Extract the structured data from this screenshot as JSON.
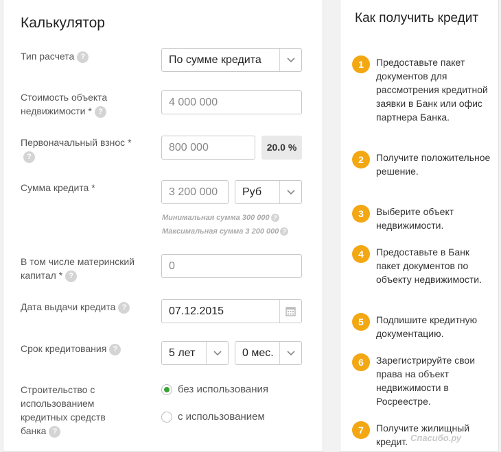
{
  "calculator": {
    "title": "Калькулятор",
    "calc_type": {
      "label": "Тип расчета",
      "value": "По сумме кредита"
    },
    "property_cost": {
      "label": "Стоимость объекта недвижимости *",
      "value": "4 000 000"
    },
    "down_payment": {
      "label": "Первоначальный взнос *",
      "value": "800 000",
      "percent": "20.0 %"
    },
    "loan_amount": {
      "label": "Сумма кредита *",
      "value": "3 200 000",
      "currency": "Руб",
      "min_hint": "Минимальная сумма 300 000",
      "max_hint": "Максимальная сумма 3 200 000"
    },
    "maternity_capital": {
      "label": "В том числе материнский капитал *",
      "value": "0"
    },
    "issue_date": {
      "label": "Дата выдачи кредита",
      "value": "07.12.2015"
    },
    "term": {
      "label": "Срок кредитования",
      "years": "5 лет",
      "months": "0 мес."
    },
    "construction": {
      "label": "Строительство с использованием кредитных средств банка",
      "options": [
        {
          "label": "без использования",
          "selected": true
        },
        {
          "label": "с использованием",
          "selected": false
        }
      ]
    },
    "help_glyph": "?"
  },
  "sidebar": {
    "title": "Как получить кредит",
    "steps": [
      {
        "num": "1",
        "text": "Предоставьте пакет документов для рассмотрения кредитной заявки в Банк или офис партнера Банка."
      },
      {
        "num": "2",
        "text": "Получите положительное решение."
      },
      {
        "num": "3",
        "text": "Выберите объект недвижимости."
      },
      {
        "num": "4",
        "text": "Предоставьте в Банк пакет документов по объекту недвижимости."
      },
      {
        "num": "5",
        "text": "Подпишите кредитную документацию."
      },
      {
        "num": "6",
        "text": "Зарегистрируйте свои права на объект недвижимости в Росреестре."
      },
      {
        "num": "7",
        "text": "Получите жилищный кредит."
      }
    ]
  },
  "watermark": "Спасибо.ру",
  "colors": {
    "accent": "#f3a712",
    "radio_selected": "#3aa335",
    "help_icon": "#d4d4d4"
  }
}
